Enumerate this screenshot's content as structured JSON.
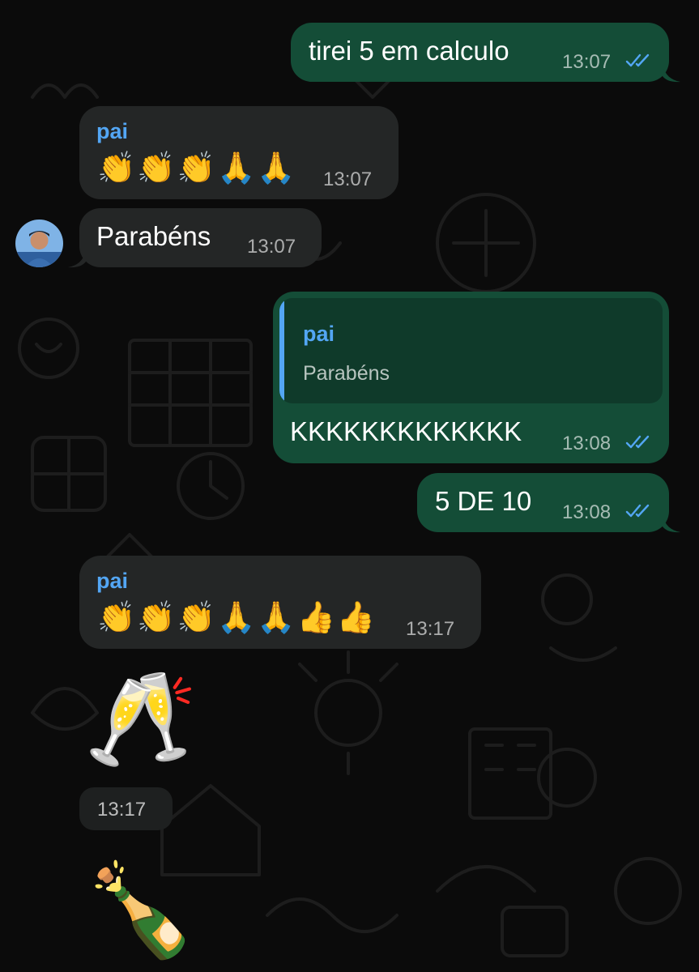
{
  "chat": {
    "messages": [
      {
        "text": "tirei 5 em calculo",
        "time": "13:07",
        "status_icon": "double-check-read-icon"
      },
      {
        "sender": "pai",
        "emojis": "👏👏👏🙏🙏",
        "time": "13:07"
      },
      {
        "text": "Parabéns",
        "time": "13:07"
      },
      {
        "quote": {
          "sender": "pai",
          "text": "Parabéns"
        },
        "text": "KKKKKKKKKKKKK",
        "time": "13:08",
        "status_icon": "double-check-read-icon"
      },
      {
        "text": "5 DE 10",
        "time": "13:08",
        "status_icon": "double-check-read-icon"
      },
      {
        "sender": "pai",
        "emojis": "👏👏👏🙏🙏👍👍",
        "time": "13:17"
      },
      {
        "sticker": "🥂",
        "time": "13:17"
      },
      {
        "sticker": "🍾"
      }
    ]
  },
  "colors": {
    "outgoing_bubble": "#144d37",
    "incoming_bubble": "#242626",
    "sender_name": "#53a6f4",
    "read_ticks": "#53a6f4",
    "background": "#0b0b0b"
  }
}
